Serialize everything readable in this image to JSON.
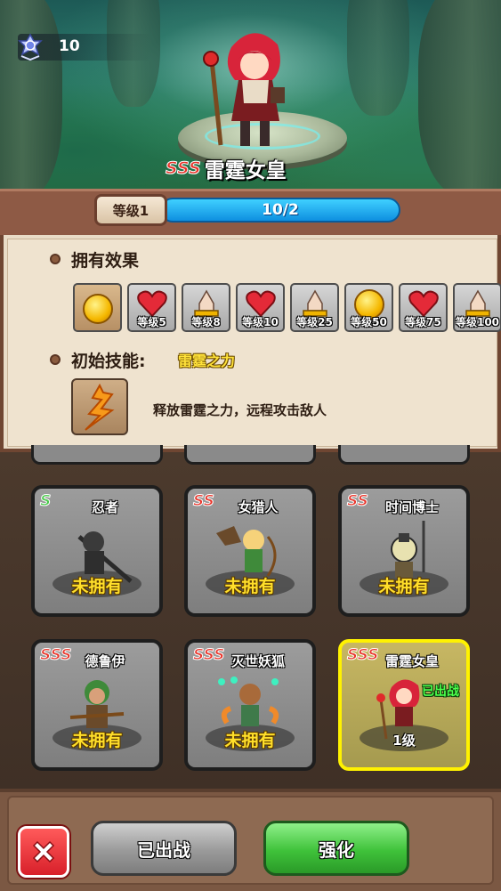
{
  "hero": {
    "rank_value": "10",
    "rarity": "SSS",
    "name": "雷霆女皇"
  },
  "level": {
    "label": "等级1",
    "progress_text": "10/2",
    "progress_fraction": 1.0,
    "bar_color": "#1aa6f0"
  },
  "effects": {
    "title": "拥有效果",
    "items": [
      {
        "icon": "coin-icon",
        "label": ""
      },
      {
        "icon": "heart-icon",
        "label": "等级5"
      },
      {
        "icon": "crystal-icon",
        "label": "等级8"
      },
      {
        "icon": "heart-icon",
        "label": "等级10"
      },
      {
        "icon": "crystal-icon",
        "label": "等级25"
      },
      {
        "icon": "coin-icon",
        "label": "等级50"
      },
      {
        "icon": "heart-icon",
        "label": "等级75"
      },
      {
        "icon": "crystal-icon",
        "label": "等级100"
      }
    ]
  },
  "skill": {
    "title": "初始技能:",
    "name": "雷霆之力",
    "icon": "lightning-icon",
    "description": "释放雷霆之力，远程攻击敌人"
  },
  "cards": [
    {
      "rarity": "S",
      "name": "忍者",
      "status": "未拥有"
    },
    {
      "rarity": "SS",
      "name": "女猎人",
      "status": "未拥有"
    },
    {
      "rarity": "SS",
      "name": "时间博士",
      "status": "未拥有"
    },
    {
      "rarity": "SSS",
      "name": "德鲁伊",
      "status": "未拥有"
    },
    {
      "rarity": "SSS",
      "name": "灭世妖狐",
      "status": "未拥有"
    },
    {
      "rarity": "SSS",
      "name": "雷霆女皇",
      "status": "1级",
      "deployed": "已出战"
    }
  ],
  "buttons": {
    "deployed": "已出战",
    "upgrade": "强化"
  },
  "colors": {
    "rarity_red": "#e8342a",
    "rarity_green": "#49c94a",
    "status_yellow": "#ffdf2a",
    "selected_border": "#fff200"
  }
}
